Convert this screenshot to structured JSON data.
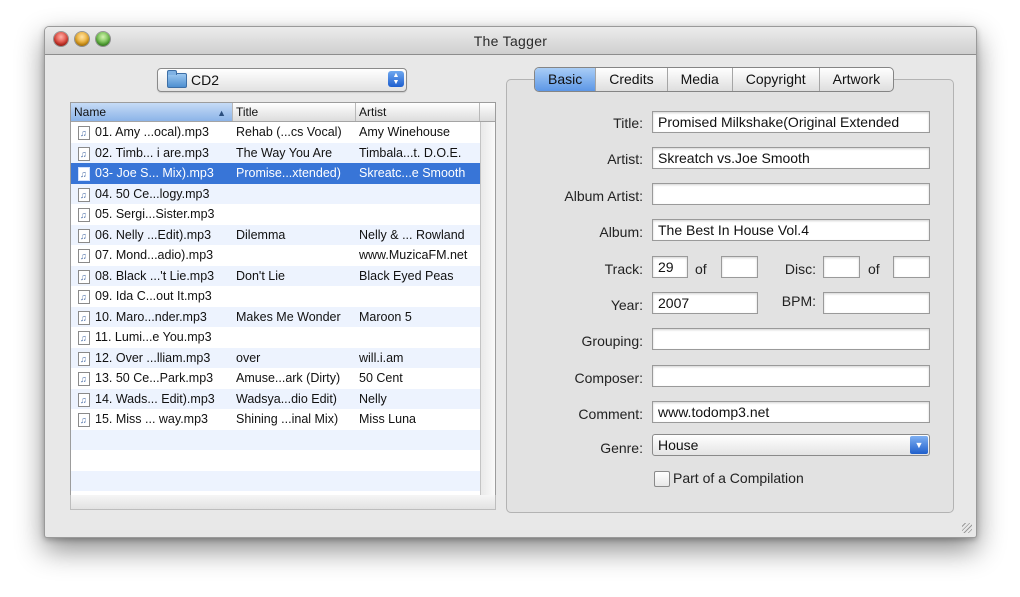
{
  "window": {
    "title": "The Tagger"
  },
  "folder_popup": {
    "label": "CD2",
    "icon": "folder-icon"
  },
  "file_list": {
    "columns": [
      "Name",
      "Title",
      "Artist"
    ],
    "rows": [
      {
        "name": "01. Amy ...ocal).mp3",
        "title": "Rehab (...cs Vocal)",
        "artist": "Amy Winehouse"
      },
      {
        "name": "02. Timb... i are.mp3",
        "title": "The Way You Are",
        "artist": "Timbala...t. D.O.E."
      },
      {
        "name": "03- Joe S... Mix).mp3",
        "title": "Promise...xtended)",
        "artist": "Skreatc...e Smooth",
        "selected": true
      },
      {
        "name": "04. 50 Ce...logy.mp3",
        "title": "",
        "artist": ""
      },
      {
        "name": "05. Sergi...Sister.mp3",
        "title": "",
        "artist": ""
      },
      {
        "name": "06. Nelly ...Edit).mp3",
        "title": "Dilemma",
        "artist": "Nelly & ... Rowland"
      },
      {
        "name": "07. Mond...adio).mp3",
        "title": "",
        "artist": "www.MuzicaFM.net"
      },
      {
        "name": "08. Black ...'t Lie.mp3",
        "title": "Don't Lie",
        "artist": "Black Eyed Peas"
      },
      {
        "name": "09. Ida C...out It.mp3",
        "title": "",
        "artist": ""
      },
      {
        "name": "10. Maro...nder.mp3",
        "title": "Makes Me Wonder",
        "artist": "Maroon 5"
      },
      {
        "name": "11. Lumi...e You.mp3",
        "title": "",
        "artist": ""
      },
      {
        "name": "12. Over ...lliam.mp3",
        "title": "over",
        "artist": "will.i.am"
      },
      {
        "name": "13. 50 Ce...Park.mp3",
        "title": "Amuse...ark (Dirty)",
        "artist": "50 Cent"
      },
      {
        "name": "14. Wads... Edit).mp3",
        "title": "Wadsya...dio Edit)",
        "artist": "Nelly"
      },
      {
        "name": "15. Miss ... way.mp3",
        "title": "Shining ...inal Mix)",
        "artist": "Miss Luna"
      },
      {
        "name": "",
        "title": "",
        "artist": ""
      },
      {
        "name": "",
        "title": "",
        "artist": ""
      },
      {
        "name": "",
        "title": "",
        "artist": ""
      }
    ]
  },
  "tabs": [
    "Basic",
    "Credits",
    "Media",
    "Copyright",
    "Artwork"
  ],
  "active_tab": "Basic",
  "form": {
    "title_label": "Title:",
    "title_value": "Promised Milkshake(Original Extended",
    "artist_label": "Artist:",
    "artist_value": "Skreatch vs.Joe Smooth",
    "album_artist_label": "Album Artist:",
    "album_artist_value": "",
    "album_label": "Album:",
    "album_value": "The Best In House Vol.4",
    "track_label": "Track:",
    "track_value": "29",
    "track_of_label": "of",
    "track_total": "",
    "disc_label": "Disc:",
    "disc_value": "",
    "disc_of_label": "of",
    "disc_total": "",
    "year_label": "Year:",
    "year_value": "2007",
    "bpm_label": "BPM:",
    "bpm_value": "",
    "grouping_label": "Grouping:",
    "grouping_value": "",
    "composer_label": "Composer:",
    "composer_value": "",
    "comment_label": "Comment:",
    "comment_value": "www.todomp3.net",
    "genre_label": "Genre:",
    "genre_value": "House",
    "compilation_label": "Part of a Compilation",
    "compilation_checked": false
  },
  "colors": {
    "selection": "#3875d7",
    "active_tab": "#6ea3ea",
    "window_bg": "#e8e8e8"
  }
}
